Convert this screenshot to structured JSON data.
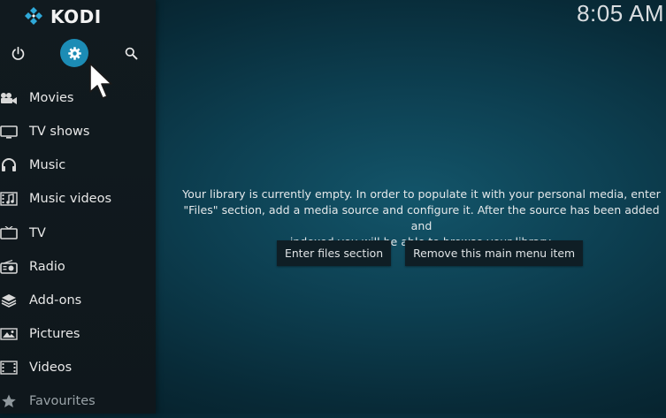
{
  "app": {
    "name": "KODI",
    "clock": "8:05 AM"
  },
  "top_buttons": {
    "power": "power-icon",
    "settings": "gear-icon",
    "search": "search-icon"
  },
  "sidebar": {
    "items": [
      {
        "label": "Movies",
        "icon": "movies-icon"
      },
      {
        "label": "TV shows",
        "icon": "tv-shows-icon"
      },
      {
        "label": "Music",
        "icon": "headphones-icon"
      },
      {
        "label": "Music videos",
        "icon": "music-videos-icon"
      },
      {
        "label": "TV",
        "icon": "tv-icon"
      },
      {
        "label": "Radio",
        "icon": "radio-icon"
      },
      {
        "label": "Add-ons",
        "icon": "addons-icon"
      },
      {
        "label": "Pictures",
        "icon": "pictures-icon"
      },
      {
        "label": "Videos",
        "icon": "videos-icon"
      },
      {
        "label": "Favourites",
        "icon": "star-icon"
      }
    ]
  },
  "main": {
    "message_line1": "Your library is currently empty. In order to populate it with your personal media, enter",
    "message_line2": "\"Files\" section, add a media source and configure it. After the source has been added and",
    "message_line3": "indexed you will be able to browse your library.",
    "enter_files_label": "Enter files section",
    "remove_item_label": "Remove this main menu item"
  },
  "colors": {
    "accent": "#1c8cb5",
    "background": "#0d4052",
    "sidebar": "#111a1f"
  }
}
